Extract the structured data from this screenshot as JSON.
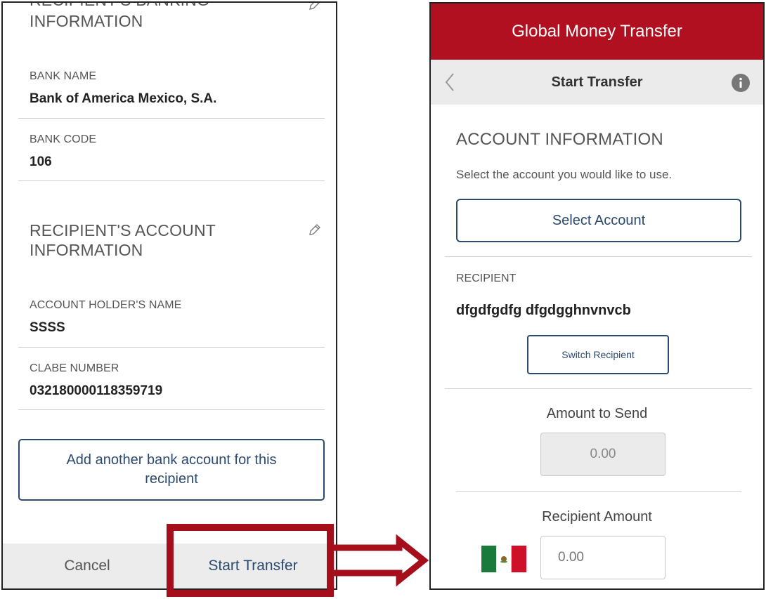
{
  "left": {
    "banking_title_line2": "INFORMATION",
    "bank_name_label": "BANK NAME",
    "bank_name_value": "Bank of America Mexico, S.A.",
    "bank_code_label": "BANK CODE",
    "bank_code_value": "106",
    "account_title_line1": "RECIPIENT'S ACCOUNT",
    "account_title_line2": "INFORMATION",
    "holder_label": "ACCOUNT HOLDER'S NAME",
    "holder_value": "SSSS",
    "clabe_label": "CLABE NUMBER",
    "clabe_value": "032180000118359719",
    "add_account_label": "Add another bank account for this recipient",
    "cancel_label": "Cancel",
    "start_transfer_label": "Start Transfer"
  },
  "right": {
    "app_title": "Global Money Transfer",
    "nav_title": "Start Transfer",
    "account_section_title": "ACCOUNT INFORMATION",
    "account_prompt": "Select the account you would like to use.",
    "select_account_label": "Select Account",
    "recipient_label": "RECIPIENT",
    "recipient_name": "dfgdfgdfg dfgdgghnvnvcb",
    "switch_recipient_label": "Switch Recipient",
    "amount_to_send_label": "Amount to Send",
    "amount_to_send_value": "0.00",
    "recipient_amount_label": "Recipient Amount",
    "recipient_amount_placeholder": "0.00"
  },
  "colors": {
    "brand_red": "#b0101f",
    "highlight_red": "#a50f1c",
    "button_navy": "#2c4a6e"
  },
  "icons": {
    "edit": "pencil-icon",
    "back": "chevron-left-icon",
    "info": "info-icon",
    "flag": "mexico-flag-icon",
    "arrow": "right-arrow-icon"
  }
}
